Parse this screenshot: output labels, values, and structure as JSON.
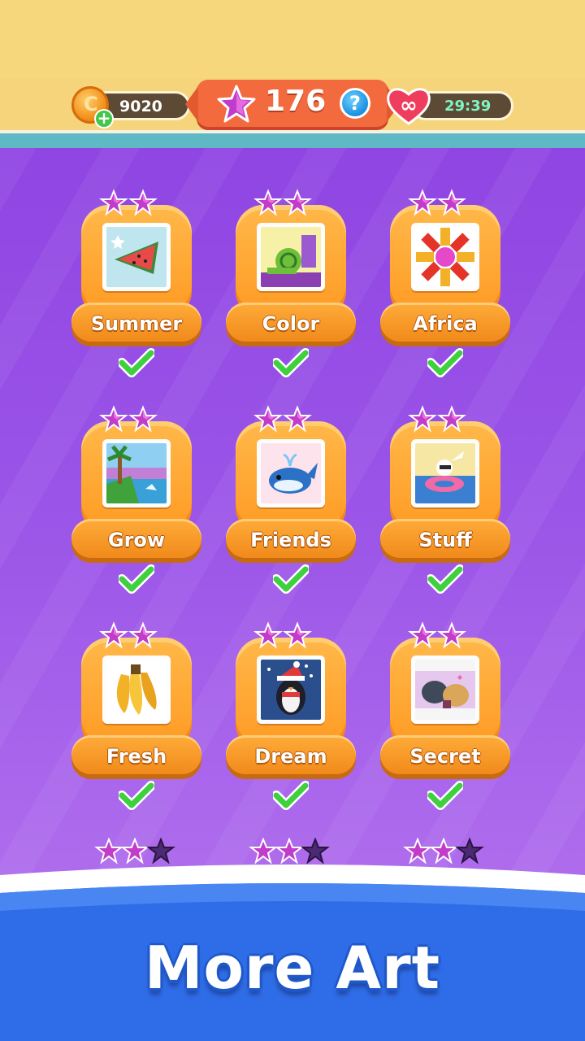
{
  "header": {
    "coins": "9020",
    "stars": "176",
    "help_symbol": "?",
    "lives_symbol": "∞",
    "lives_timer": "29:39"
  },
  "levels": [
    {
      "label": "Summer",
      "stars_earned": 2,
      "completed": true,
      "art": "watermelon"
    },
    {
      "label": "Color",
      "stars_earned": 2,
      "completed": true,
      "art": "snail"
    },
    {
      "label": "Africa",
      "stars_earned": 2,
      "completed": true,
      "art": "flower"
    },
    {
      "label": "Grow",
      "stars_earned": 2,
      "completed": true,
      "art": "palm-landscape"
    },
    {
      "label": "Friends",
      "stars_earned": 2,
      "completed": true,
      "art": "whale"
    },
    {
      "label": "Stuff",
      "stars_earned": 2,
      "completed": true,
      "art": "bunny-float"
    },
    {
      "label": "Fresh",
      "stars_earned": 2,
      "completed": true,
      "art": "banana"
    },
    {
      "label": "Dream",
      "stars_earned": 2,
      "completed": true,
      "art": "penguin"
    },
    {
      "label": "Secret",
      "stars_earned": 2,
      "completed": true,
      "art": "dogs"
    }
  ],
  "footer": {
    "more_art_label": "More Art"
  },
  "colors": {
    "background": "#9b55e8",
    "header": "#f6d77b",
    "card_orange": "#ff9a22",
    "star_pink": "#e23ad3",
    "check_green": "#3fcf3f",
    "footer_blue": "#2f6de8"
  }
}
